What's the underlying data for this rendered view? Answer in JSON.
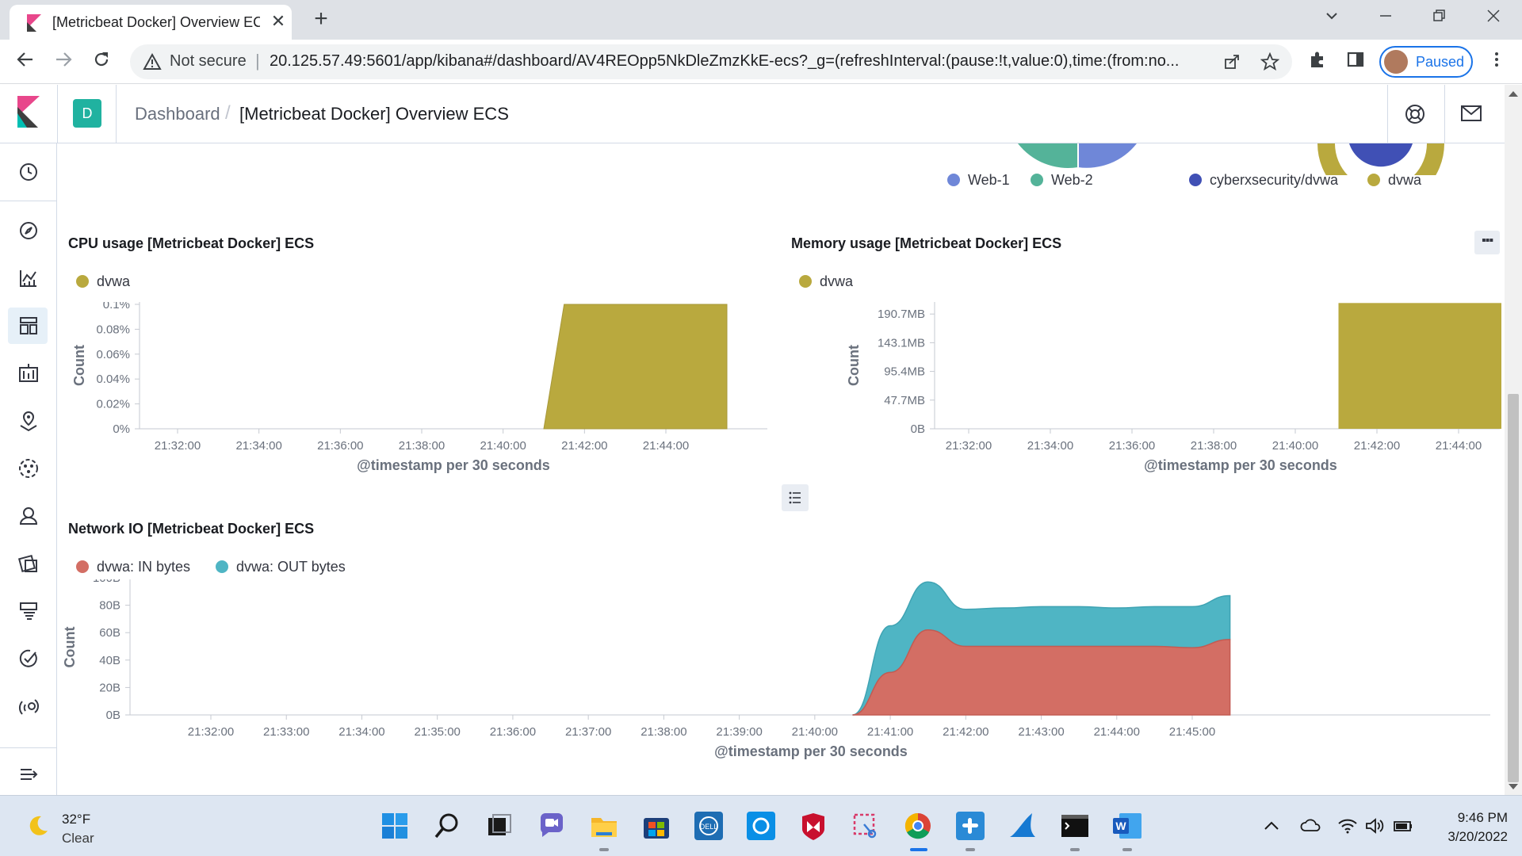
{
  "browser": {
    "tab_title": "[Metricbeat Docker] Overview ECS",
    "tab_close": "✕",
    "new_tab": "+",
    "not_secure": "Not secure",
    "url": "20.125.57.49:5601/app/kibana#/dashboard/AV4REOpp5NkDleZmzKkE-ecs?_g=(refreshInterval:(pause:!t,value:0),time:(from:no...",
    "profile_label": "Paused",
    "icons": [
      "back-icon",
      "forward-icon",
      "reload-icon",
      "warning-icon",
      "share-icon",
      "star-icon",
      "extensions-icon",
      "sidepanel-icon",
      "menu-icon"
    ]
  },
  "kibana": {
    "space_initial": "D",
    "breadcrumbs": [
      "Dashboard",
      "[Metricbeat Docker] Overview ECS"
    ],
    "breadcrumb_sep": "/",
    "nav_icons": [
      "clock-icon",
      "discover-icon",
      "visualize-icon",
      "dashboard-icon",
      "canvas-icon",
      "maps-icon",
      "ml-icon",
      "graph-icon",
      "apm-icon",
      "logs-icon",
      "uptime-icon",
      "siem-icon",
      "collapse-nav-icon"
    ]
  },
  "top_legends": {
    "left": [
      {
        "label": "Web-1",
        "color": "#6f87d8"
      },
      {
        "label": "Web-2",
        "color": "#54b399"
      }
    ],
    "right": [
      {
        "label": "cyberxsecurity/dvwa",
        "color": "#4050b5"
      },
      {
        "label": "dvwa",
        "color": "#b9a93e"
      }
    ]
  },
  "panel_menu": "▪▪▪",
  "chart_data": [
    {
      "type": "area",
      "title": "CPU usage [Metricbeat Docker] ECS",
      "ylabel": "Count",
      "xlabel": "@timestamp per 30 seconds",
      "y_ticks": [
        "0%",
        "0.02%",
        "0.04%",
        "0.06%",
        "0.08%",
        "0.1%"
      ],
      "x_ticks": [
        "21:32:00",
        "21:34:00",
        "21:36:00",
        "21:38:00",
        "21:40:00",
        "21:42:00",
        "21:44:00"
      ],
      "series": [
        {
          "name": "dvwa",
          "color": "#b9a93e",
          "x": [
            "21:41:00",
            "21:41:30",
            "21:45:30"
          ],
          "values": [
            0,
            0.1,
            0.1
          ]
        }
      ]
    },
    {
      "type": "bar",
      "title": "Memory usage [Metricbeat Docker] ECS",
      "ylabel": "Count",
      "xlabel": "@timestamp per 30 seconds",
      "y_ticks": [
        "0B",
        "47.7MB",
        "95.4MB",
        "143.1MB",
        "190.7MB"
      ],
      "x_ticks": [
        "21:32:00",
        "21:34:00",
        "21:36:00",
        "21:38:00",
        "21:40:00",
        "21:42:00",
        "21:44:00"
      ],
      "series": [
        {
          "name": "dvwa",
          "color": "#b9a93e",
          "x_start": "21:41:00",
          "x_end": "21:45:30",
          "value_mb": 209
        }
      ]
    },
    {
      "type": "area",
      "title": "Network IO [Metricbeat Docker] ECS",
      "ylabel": "Count",
      "xlabel": "@timestamp per 30 seconds",
      "stacked": true,
      "y_ticks": [
        "0B",
        "20B",
        "40B",
        "60B",
        "80B",
        "100B"
      ],
      "x_ticks": [
        "21:32:00",
        "21:33:00",
        "21:34:00",
        "21:35:00",
        "21:36:00",
        "21:37:00",
        "21:38:00",
        "21:39:00",
        "21:40:00",
        "21:41:00",
        "21:42:00",
        "21:43:00",
        "21:44:00",
        "21:45:00"
      ],
      "x": [
        "21:40:30",
        "21:41:00",
        "21:41:30",
        "21:42:00",
        "21:42:30",
        "21:43:00",
        "21:43:30",
        "21:44:00",
        "21:44:30",
        "21:45:00",
        "21:45:30"
      ],
      "series": [
        {
          "name": "dvwa: IN bytes",
          "color": "#d36e64",
          "values": [
            0,
            31,
            62,
            50,
            50,
            50,
            50,
            50,
            50,
            49,
            55
          ]
        },
        {
          "name": "dvwa: OUT bytes",
          "color": "#4fb5c4",
          "values": [
            0,
            34,
            35,
            27,
            28,
            29,
            29,
            28,
            29,
            30,
            32
          ]
        }
      ]
    }
  ],
  "taskbar": {
    "weather_temp": "32°F",
    "weather_desc": "Clear",
    "time": "9:46 PM",
    "date": "3/20/2022",
    "apps": [
      "start-icon",
      "search-icon",
      "taskview-icon",
      "chat-icon",
      "explorer-icon",
      "store-icon",
      "dell-icon",
      "cortana-icon",
      "mcafee-icon",
      "snip-icon",
      "chrome-icon",
      "slack-icon",
      "wireshark-icon",
      "terminal-icon",
      "word-icon"
    ]
  }
}
